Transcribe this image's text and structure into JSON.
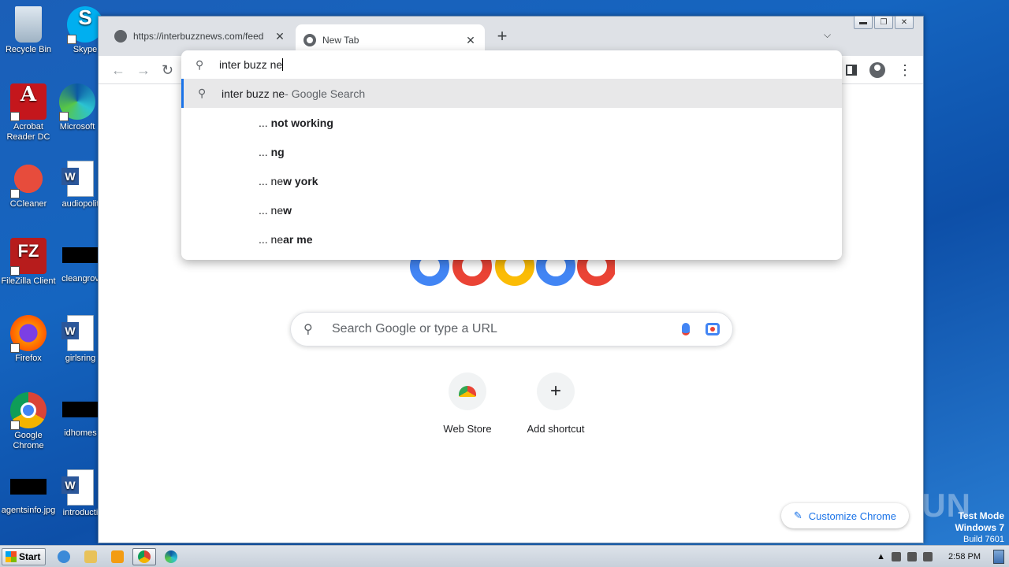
{
  "desktop": {
    "icons": [
      {
        "label": "Recycle Bin",
        "icon": "recycle-bin-icon"
      },
      {
        "label": "Skype",
        "icon": "skype-icon"
      },
      {
        "label": "Acrobat Reader DC",
        "icon": "acrobat-icon"
      },
      {
        "label": "Microsoft",
        "icon": "edge-icon"
      },
      {
        "label": "CCleaner",
        "icon": "ccleaner-icon"
      },
      {
        "label": "audiopolit",
        "icon": "word-doc-icon"
      },
      {
        "label": "FileZilla Client",
        "icon": "filezilla-icon"
      },
      {
        "label": "cleangrov",
        "icon": "black-image-icon"
      },
      {
        "label": "Firefox",
        "icon": "firefox-icon"
      },
      {
        "label": "girlsring",
        "icon": "word-doc-icon"
      },
      {
        "label": "Google Chrome",
        "icon": "chrome-icon"
      },
      {
        "label": "idhomes",
        "icon": "black-image-icon"
      },
      {
        "label": "agentsinfo.jpg",
        "icon": "black-image-icon"
      },
      {
        "label": "introducti",
        "icon": "word-doc-icon"
      }
    ]
  },
  "browser": {
    "tabs": [
      {
        "title": "https://interbuzznews.com/feed",
        "active": false
      },
      {
        "title": "New Tab",
        "active": true
      }
    ],
    "new_tab_symbol": "+",
    "tab_close_symbol": "✕",
    "omnibox": {
      "typed": "inter buzz ne",
      "top_suggestion": {
        "query": "inter buzz ne",
        "suffix": " - Google Search"
      },
      "suggestions": [
        {
          "prefix": "... ",
          "rest": "not working"
        },
        {
          "prefix": "... ",
          "rest": "ng"
        },
        {
          "prefix": "... ne",
          "rest": "w york"
        },
        {
          "prefix": "... ne",
          "rest": "w"
        },
        {
          "prefix": "... ne",
          "rest": "ar me"
        }
      ]
    }
  },
  "ntp": {
    "search_placeholder": "Search Google or type a URL",
    "shortcuts": [
      {
        "label": "Web Store"
      },
      {
        "label": "Add shortcut",
        "symbol": "+"
      }
    ],
    "customize_label": "Customize Chrome",
    "logo_colors": [
      "#4285f4",
      "#ea4335",
      "#fbbc05",
      "#4285f4",
      "#34a853",
      "#ea4335"
    ]
  },
  "watermark": "ANY.RUN",
  "system": {
    "test_mode_line1": "Test Mode",
    "test_mode_line2": "Windows 7",
    "build": "Build 7601",
    "start_label": "Start",
    "clock": "2:58 PM"
  }
}
